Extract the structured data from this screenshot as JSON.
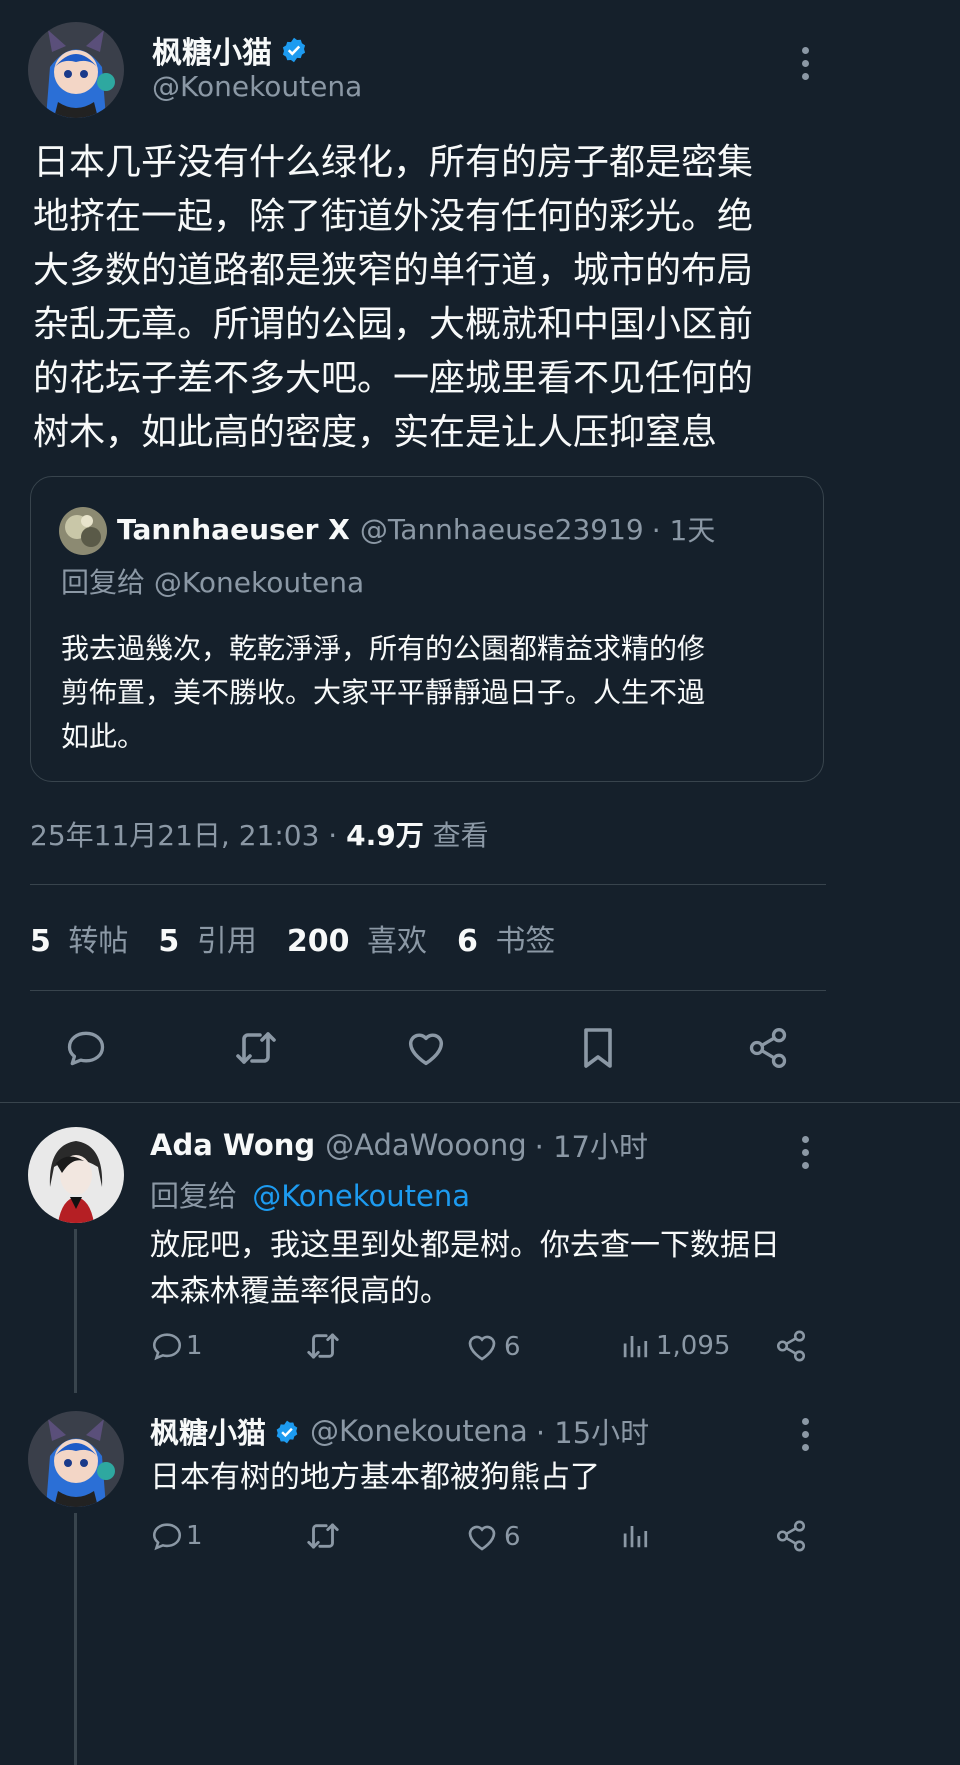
{
  "colors": {
    "bg": "#15202b",
    "text": "#f7f9f9",
    "muted": "#8b98a5",
    "accent": "#1d9bf0",
    "verified": "#1d9bf0"
  },
  "main_tweet": {
    "author_name": "枫糖小猫",
    "author_handle": "@Konekoutena",
    "text_lines": [
      "日本几乎没有什么绿化，所有的房子都是密集",
      "地挤在一起，除了街道外没有任何的彩光。绝",
      "大多数的道路都是狭窄的单行道，城市的布局",
      "杂乱无章。所谓的公园，大概就和中国小区前",
      "的花坛子差不多大吧。一座城里看不见任何的",
      "树木，如此高的密度，实在是让人压抑窒息"
    ],
    "timestamp": "25年11月21日, 21:03",
    "view_count": "4.9万",
    "view_label": "查看"
  },
  "quoted_tweet": {
    "author_name": "Tannhaeuser X",
    "author_handle": "@Tannhaeuse23919",
    "time": "· 1天",
    "reply_to": "回复给 @Konekoutena",
    "text_lines": [
      "我去過幾次，乾乾淨淨，所有的公園都精益求精的修",
      "剪佈置，美不勝收。大家平平靜靜過日子。人生不過",
      "如此。"
    ]
  },
  "stats": {
    "retweets": "5",
    "retweets_label": "转帖",
    "quotes": "5",
    "quotes_label": "引用",
    "likes": "200",
    "likes_label": "喜欢",
    "bookmarks": "6",
    "bookmarks_label": "书签"
  },
  "actions": [
    "reply-icon",
    "retweet-icon",
    "heart-icon",
    "bookmark-icon",
    "share-icon"
  ],
  "replies": [
    {
      "author_name": "Ada Wong",
      "author_handle": "@AdaWooong",
      "time": "· 17小时",
      "reply_prefix": "回复给",
      "reply_handle": "@Konekoutena",
      "text_lines": [
        "放屁吧，我这里到处都是树。你去查一下数据日",
        "本森林覆盖率很高的。"
      ],
      "reply_count": "1",
      "like_count": "6",
      "view_count": "1,095"
    },
    {
      "author_name": "枫糖小猫",
      "author_handle": "@Konekoutena",
      "time": "· 15小时",
      "text_lines": [
        "日本有树的地方基本都被狗熊占了"
      ],
      "reply_count": "1",
      "like_count": "6",
      "view_count": ""
    }
  ]
}
